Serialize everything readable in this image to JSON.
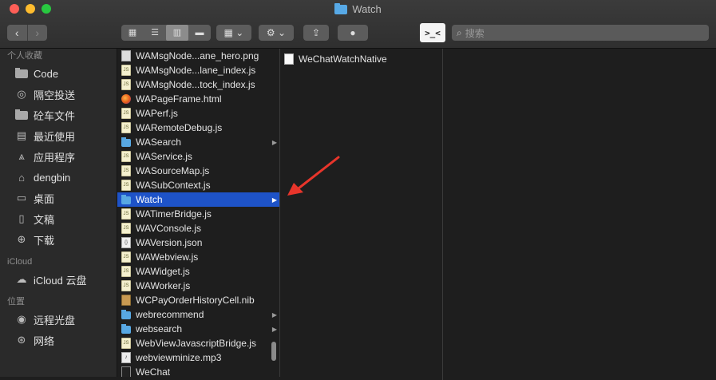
{
  "window": {
    "title": "Watch"
  },
  "toolbar": {
    "back": "‹",
    "forward": "›",
    "views": [
      "▦",
      "☰",
      "▥",
      "▬"
    ],
    "group_icon": "▦ ⌄",
    "action_icon": "⚙ ⌄",
    "share_icon": "⇪",
    "tag_icon": "●",
    "terminal_label": ">_<",
    "search_placeholder": "搜索"
  },
  "sidebar": {
    "sections": [
      {
        "title": "个人收藏",
        "items": [
          {
            "label": "Code",
            "icon": "folder-icon"
          },
          {
            "label": "隔空投送",
            "icon": "airdrop-icon"
          },
          {
            "label": "砼车文件",
            "icon": "folder-icon"
          },
          {
            "label": "最近使用",
            "icon": "recents-icon"
          },
          {
            "label": "应用程序",
            "icon": "applications-icon"
          },
          {
            "label": "dengbin",
            "icon": "home-icon"
          },
          {
            "label": "桌面",
            "icon": "desktop-icon"
          },
          {
            "label": "文稿",
            "icon": "documents-icon"
          },
          {
            "label": "下载",
            "icon": "downloads-icon"
          }
        ]
      },
      {
        "title": "iCloud",
        "items": [
          {
            "label": "iCloud 云盘",
            "icon": "cloud-icon"
          }
        ]
      },
      {
        "title": "位置",
        "items": [
          {
            "label": "远程光盘",
            "icon": "disc-icon"
          },
          {
            "label": "网络",
            "icon": "network-icon"
          }
        ]
      }
    ]
  },
  "column1": [
    {
      "name": "WAMsgNode...ane_hero.png",
      "type": "png"
    },
    {
      "name": "WAMsgNode...lane_index.js",
      "type": "js"
    },
    {
      "name": "WAMsgNode...tock_index.js",
      "type": "js"
    },
    {
      "name": "WAPageFrame.html",
      "type": "html"
    },
    {
      "name": "WAPerf.js",
      "type": "js"
    },
    {
      "name": "WARemoteDebug.js",
      "type": "js"
    },
    {
      "name": "WASearch",
      "type": "folder"
    },
    {
      "name": "WAService.js",
      "type": "js"
    },
    {
      "name": "WASourceMap.js",
      "type": "js"
    },
    {
      "name": "WASubContext.js",
      "type": "js"
    },
    {
      "name": "Watch",
      "type": "folder",
      "selected": true
    },
    {
      "name": "WATimerBridge.js",
      "type": "js"
    },
    {
      "name": "WAVConsole.js",
      "type": "js"
    },
    {
      "name": "WAVersion.json",
      "type": "json"
    },
    {
      "name": "WAWebview.js",
      "type": "js"
    },
    {
      "name": "WAWidget.js",
      "type": "js"
    },
    {
      "name": "WAWorker.js",
      "type": "js"
    },
    {
      "name": "WCPayOrderHistoryCell.nib",
      "type": "nib"
    },
    {
      "name": "webrecommend",
      "type": "folder"
    },
    {
      "name": "websearch",
      "type": "folder"
    },
    {
      "name": "WebViewJavascriptBridge.js",
      "type": "js"
    },
    {
      "name": "webviewminize.mp3",
      "type": "mp3"
    },
    {
      "name": "WeChat",
      "type": "app"
    }
  ],
  "column2": [
    {
      "name": "WeChatWatchNative",
      "type": "doc"
    }
  ],
  "colors": {
    "selection": "#1e53c8",
    "annotation_arrow": "#e8352b"
  }
}
